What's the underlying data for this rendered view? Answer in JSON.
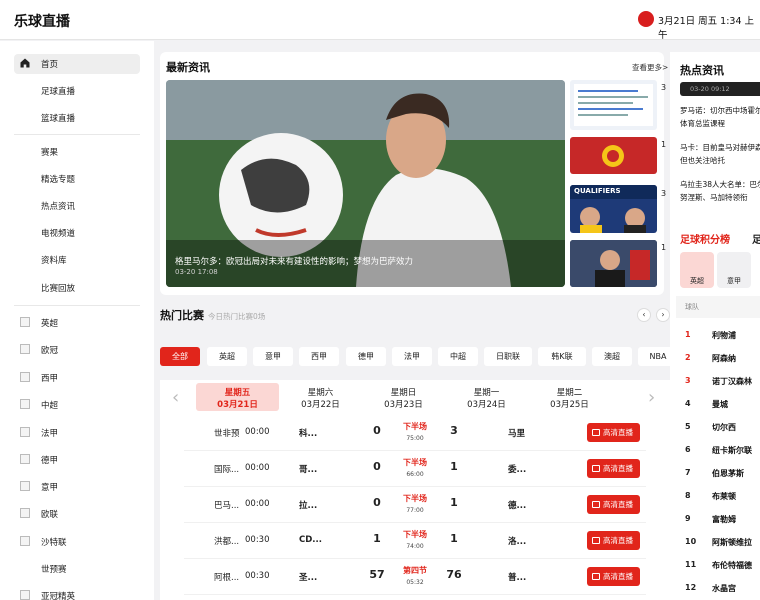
{
  "app": {
    "title": "乐球直播",
    "datetime": "3月21日 周五 1:34 上午"
  },
  "sidebar": {
    "main": [
      "首页",
      "足球直播",
      "篮球直播"
    ],
    "sections": [
      "赛果",
      "精选专题",
      "热点资讯",
      "电视频道",
      "资料库",
      "比赛回放"
    ],
    "leagues": [
      "英超",
      "欧冠",
      "西甲",
      "中超",
      "法甲",
      "德甲",
      "意甲",
      "欧联",
      "沙特联",
      "世预赛",
      "亚冠精英"
    ]
  },
  "news": {
    "title": "最新资讯",
    "see_more": "查看更多>",
    "hero_caption": "格里马尔多：欧冠出局对未来有建设性的影响；梦想为巴萨效力",
    "hero_date": "03-20 17:08",
    "thumb_labels": [
      "QUALIFIERS"
    ],
    "side_snips": [
      "3",
      "1",
      "3",
      "1"
    ]
  },
  "hot_news": {
    "title": "热点资讯",
    "time": "03-20 09:12",
    "items": [
      "罗马诺：切尔西中场霍尔",
      "体育总监课程",
      "马卡：目前皇马对赫伊森",
      "但也关注哈托",
      "乌拉圭38人大名单：巴尔",
      "努涅斯、马加特领衔"
    ]
  },
  "standings": {
    "title": "足球积分榜",
    "title2": "足",
    "league_buttons": [
      "英超",
      "意甲"
    ],
    "header": "球队",
    "rows": [
      {
        "rank": "1",
        "team": "利物浦"
      },
      {
        "rank": "2",
        "team": "阿森纳"
      },
      {
        "rank": "3",
        "team": "诺丁汉森林"
      },
      {
        "rank": "4",
        "team": "曼城"
      },
      {
        "rank": "5",
        "team": "切尔西"
      },
      {
        "rank": "6",
        "team": "纽卡斯尔联"
      },
      {
        "rank": "7",
        "team": "伯恩茅斯"
      },
      {
        "rank": "8",
        "team": "布莱顿"
      },
      {
        "rank": "9",
        "team": "富勒姆"
      },
      {
        "rank": "10",
        "team": "阿斯顿维拉"
      },
      {
        "rank": "11",
        "team": "布伦特福德"
      },
      {
        "rank": "12",
        "team": "水晶宫"
      }
    ],
    "rank_colors": {
      "top": "#e1251b",
      "normal": "#222222"
    }
  },
  "hot_matches": {
    "title": "热门比赛",
    "subtitle": "今日热门比赛0场",
    "filters": [
      "全部",
      "英超",
      "意甲",
      "西甲",
      "德甲",
      "法甲",
      "中超",
      "日职联",
      "韩K联",
      "澳超",
      "NBA"
    ],
    "days": [
      {
        "name": "星期五",
        "date": "03月21日"
      },
      {
        "name": "星期六",
        "date": "03月22日"
      },
      {
        "name": "星期日",
        "date": "03月23日"
      },
      {
        "name": "星期一",
        "date": "03月24日"
      },
      {
        "name": "星期二",
        "date": "03月25日"
      }
    ],
    "button_label": "高清直播",
    "matches": [
      {
        "league": "世非预",
        "time": "00:00",
        "home": "科...",
        "home_score": "0",
        "status": "下半场",
        "clock": "75:00",
        "away_score": "3",
        "away": "马里"
      },
      {
        "league": "国际...",
        "time": "00:00",
        "home": "哥...",
        "home_score": "0",
        "status": "下半场",
        "clock": "66:00",
        "away_score": "1",
        "away": "委..."
      },
      {
        "league": "巴马...",
        "time": "00:00",
        "home": "拉...",
        "home_score": "0",
        "status": "下半场",
        "clock": "77:00",
        "away_score": "1",
        "away": "德..."
      },
      {
        "league": "洪都...",
        "time": "00:30",
        "home": "CD...",
        "home_score": "1",
        "status": "下半场",
        "clock": "74:00",
        "away_score": "1",
        "away": "洛..."
      },
      {
        "league": "阿根...",
        "time": "00:30",
        "home": "圣...",
        "home_score": "57",
        "status": "第四节",
        "clock": "05:32",
        "away_score": "76",
        "away": "普..."
      }
    ]
  },
  "colors": {
    "accent": "#e1251b",
    "accent_light": "#fbd7d4"
  }
}
